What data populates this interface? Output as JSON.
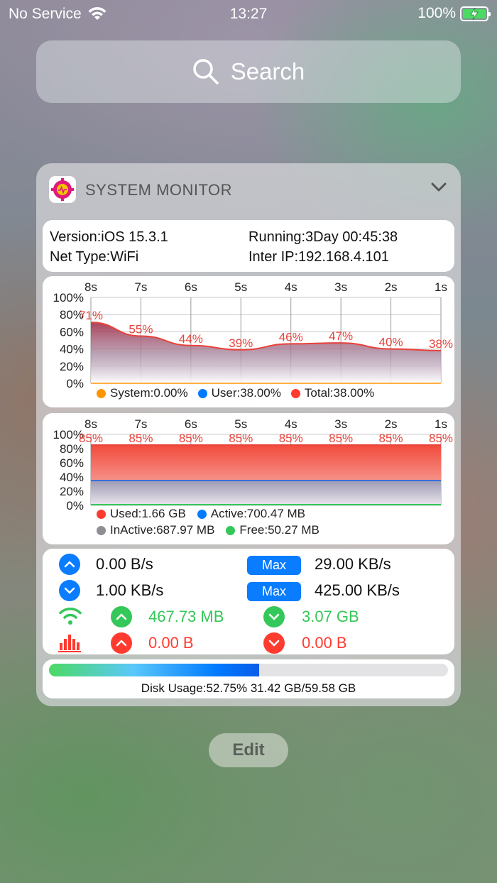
{
  "status_bar": {
    "carrier": "No Service",
    "time": "13:27",
    "battery": "100%"
  },
  "search": {
    "placeholder": "Search"
  },
  "widget": {
    "title": "SYSTEM MONITOR",
    "info": {
      "version": "Version:iOS 15.3.1",
      "running": "Running:3Day 00:45:38",
      "net_type": "Net Type:WiFi",
      "inter_ip": "Inter IP:192.168.4.101"
    },
    "cpu_chart": {
      "type": "area",
      "x": [
        "8s",
        "7s",
        "6s",
        "5s",
        "4s",
        "3s",
        "2s",
        "1s"
      ],
      "yticks": [
        "100%",
        "80%",
        "60%",
        "40%",
        "20%",
        "0%"
      ],
      "ylim": [
        0,
        100
      ],
      "values": [
        71,
        55,
        44,
        39,
        46,
        47,
        40,
        38
      ],
      "labels": [
        "71%",
        "55%",
        "44%",
        "39%",
        "46%",
        "47%",
        "40%",
        "38%"
      ],
      "legend": [
        {
          "label": "System:0.00%",
          "color": "#ff9500"
        },
        {
          "label": "User:38.00%",
          "color": "#007aff"
        },
        {
          "label": "Total:38.00%",
          "color": "#ff3b30"
        }
      ]
    },
    "mem_chart": {
      "type": "area",
      "x": [
        "8s",
        "7s",
        "6s",
        "5s",
        "4s",
        "3s",
        "2s",
        "1s"
      ],
      "yticks": [
        "100%",
        "80%",
        "60%",
        "40%",
        "20%",
        "0%"
      ],
      "ylim": [
        0,
        100
      ],
      "used": [
        85,
        85,
        85,
        85,
        85,
        85,
        85,
        85
      ],
      "active": [
        35,
        35,
        35,
        35,
        35,
        35,
        35,
        35
      ],
      "free": [
        1,
        1,
        1,
        1,
        1,
        1,
        1,
        1
      ],
      "labels": [
        "85%",
        "85%",
        "85%",
        "85%",
        "85%",
        "85%",
        "85%",
        "85%"
      ],
      "legend": [
        {
          "label": "Used:1.66 GB",
          "color": "#ff3b30"
        },
        {
          "label": "Active:700.47 MB",
          "color": "#007aff"
        },
        {
          "label": "InActive:687.97 MB",
          "color": "#8e8e93"
        },
        {
          "label": "Free:50.27 MB",
          "color": "#34c759"
        }
      ]
    },
    "network": {
      "upload_speed": "0.00 B/s",
      "upload_max_label": "Max",
      "upload_max": "29.00 KB/s",
      "download_speed": "1.00 KB/s",
      "download_max_label": "Max",
      "download_max": "425.00 KB/s",
      "wifi_up": "467.73 MB",
      "wifi_down": "3.07 GB",
      "cell_up": "0.00 B",
      "cell_down": "0.00 B"
    },
    "disk": {
      "usage_fraction": 0.5275,
      "text": "Disk Usage:52.75%  31.42 GB/59.58 GB"
    }
  },
  "edit_button": {
    "label": "Edit"
  },
  "colors": {
    "accent": "#0a7cff",
    "green": "#34c759",
    "red": "#ff3b30",
    "chart_red": "#e8423a"
  }
}
